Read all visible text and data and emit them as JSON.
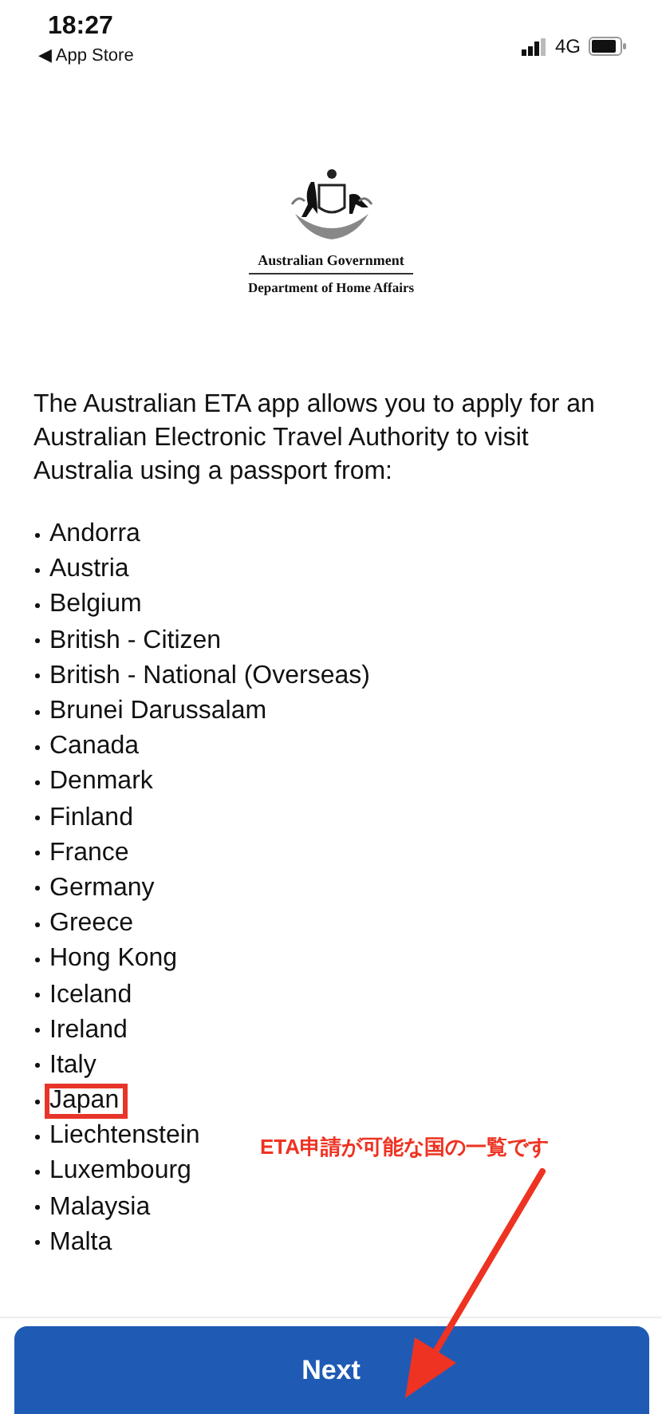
{
  "status_bar": {
    "time": "18:27",
    "back_label": "◀ App Store",
    "network": "4G"
  },
  "logo": {
    "line_1": "Australian Government",
    "line_2": "Department of Home Affairs"
  },
  "intro": "The Australian ETA app allows you to apply for an Australian Electronic Travel Authority to visit Australia using a passport from:",
  "countries": [
    {
      "name": "Andorra",
      "highlighted": false
    },
    {
      "name": "Austria",
      "highlighted": false
    },
    {
      "name": "Belgium",
      "highlighted": false
    },
    {
      "name": "British - Citizen",
      "highlighted": false
    },
    {
      "name": "British - National (Overseas)",
      "highlighted": false
    },
    {
      "name": "Brunei Darussalam",
      "highlighted": false
    },
    {
      "name": "Canada",
      "highlighted": false
    },
    {
      "name": "Denmark",
      "highlighted": false
    },
    {
      "name": "Finland",
      "highlighted": false
    },
    {
      "name": "France",
      "highlighted": false
    },
    {
      "name": "Germany",
      "highlighted": false
    },
    {
      "name": "Greece",
      "highlighted": false
    },
    {
      "name": "Hong Kong",
      "highlighted": false
    },
    {
      "name": "Iceland",
      "highlighted": false
    },
    {
      "name": "Ireland",
      "highlighted": false
    },
    {
      "name": "Italy",
      "highlighted": false
    },
    {
      "name": "Japan",
      "highlighted": true
    },
    {
      "name": "Liechtenstein",
      "highlighted": false
    },
    {
      "name": "Luxembourg",
      "highlighted": false
    },
    {
      "name": "Malaysia",
      "highlighted": false
    },
    {
      "name": "Malta",
      "highlighted": false
    }
  ],
  "annotation": "ETA申請が可能な国の一覧です",
  "next_button": "Next"
}
